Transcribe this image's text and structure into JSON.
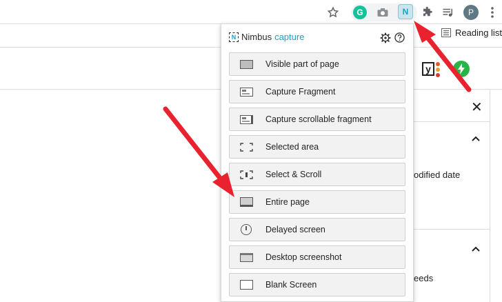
{
  "browser": {
    "toolbar_icons": [
      "star-icon",
      "grammarly-icon",
      "camera-icon",
      "nimbus-icon",
      "puzzle-icon",
      "media-queue-icon",
      "profile-avatar",
      "more-vert-icon"
    ],
    "grammarly_letter": "G",
    "nimbus_letter": "N",
    "profile_initial": "P",
    "reading_list_label": "Reading list"
  },
  "page": {
    "text_modified_date": "odified date",
    "text_needs": "eeds",
    "yoast_letter": "y"
  },
  "popup": {
    "logo_name": "Nimbus",
    "logo_suffix": "capture",
    "logo_mark": "N",
    "menu_items": [
      {
        "label": "Visible part of page",
        "icon": "visible-page-icon"
      },
      {
        "label": "Capture Fragment",
        "icon": "fragment-icon"
      },
      {
        "label": "Capture scrollable fragment",
        "icon": "scroll-fragment-icon"
      },
      {
        "label": "Selected area",
        "icon": "selected-area-icon"
      },
      {
        "label": "Select & Scroll",
        "icon": "select-scroll-icon"
      },
      {
        "label": "Entire page",
        "icon": "entire-page-icon"
      },
      {
        "label": "Delayed screen",
        "icon": "timer-icon"
      },
      {
        "label": "Desktop screenshot",
        "icon": "desktop-icon"
      },
      {
        "label": "Blank Screen",
        "icon": "blank-icon"
      }
    ]
  },
  "colors": {
    "annotation_arrow": "#e8232f",
    "nimbus_accent": "#1aa0c8",
    "grammarly": "#15c39a"
  }
}
